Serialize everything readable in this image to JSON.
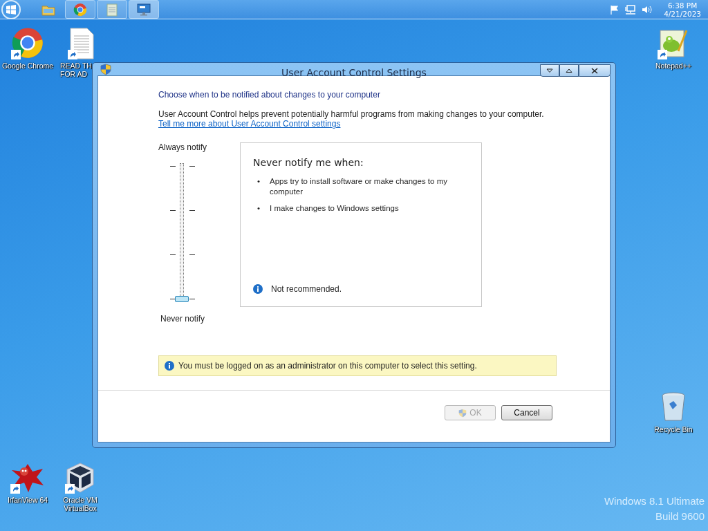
{
  "taskbar": {
    "items": [
      {
        "kind": "folder",
        "running": false,
        "selected": false
      },
      {
        "kind": "chrome",
        "running": true,
        "selected": false
      },
      {
        "kind": "notepad",
        "running": true,
        "selected": false
      },
      {
        "kind": "monitor",
        "running": true,
        "selected": true
      }
    ],
    "clock": {
      "time": "6:38 PM",
      "date": "4/21/2023"
    }
  },
  "desktop_icons": [
    {
      "kind": "chrome",
      "lines": [
        "Google Chrome"
      ]
    },
    {
      "kind": "document",
      "lines": [
        "READ TH",
        "FOR AD"
      ]
    },
    {
      "kind": "notepadpp",
      "lines": [
        "Notepad++"
      ]
    },
    {
      "kind": "recycle",
      "lines": [
        "Recycle Bin"
      ]
    },
    {
      "kind": "irfanview",
      "lines": [
        "IrfanView 64"
      ]
    },
    {
      "kind": "virtualbox",
      "lines": [
        "Oracle VM",
        "VirtualBox"
      ]
    }
  ],
  "dialog": {
    "title": "User Account Control Settings",
    "heading": "Choose when to be notified about changes to your computer",
    "description": "User Account Control helps prevent potentially harmful programs from making changes to your computer.",
    "link": "Tell me more about User Account Control settings",
    "slider": {
      "top_label": "Always notify",
      "bottom_label": "Never notify",
      "level": 0
    },
    "info": {
      "title": "Never notify me when:",
      "marker": "•",
      "bullets": [
        "Apps try to install software or make changes to my computer",
        "I make changes to Windows settings"
      ],
      "note": "Not recommended."
    },
    "warning": "You must be logged on as an administrator on this computer to select this setting.",
    "buttons": [
      {
        "label": "OK",
        "kind": "shield",
        "disabled": true
      },
      {
        "label": "Cancel",
        "kind": "plain",
        "disabled": false
      }
    ]
  },
  "watermark_os": {
    "edition": "Windows 8.1 Ultimate",
    "build": "Build 9600"
  }
}
